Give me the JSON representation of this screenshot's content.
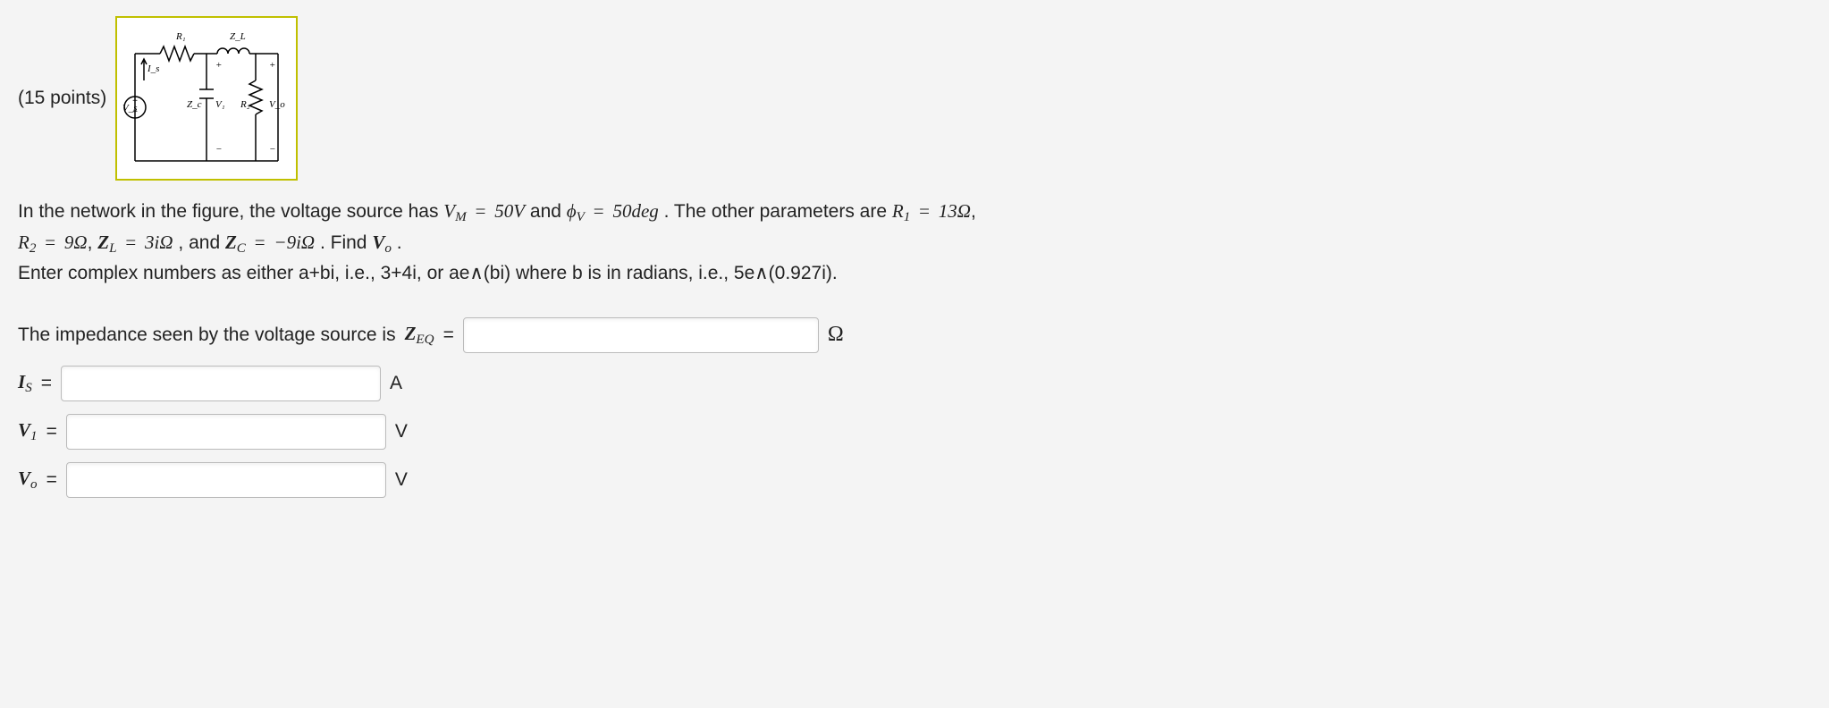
{
  "points_label": "(15 points)",
  "circuit": {
    "labels": {
      "Vs": "V_s",
      "Is": "I_s",
      "R1": "R_1",
      "ZL": "Z_L",
      "Zc": "Z_c",
      "V1": "V_1",
      "R2": "R_2",
      "Vo": "V_o"
    }
  },
  "problem": {
    "lead": "In the network in the figure, the voltage source has ",
    "Vm_lhs": "V_M",
    "Vm_val": "50V",
    "and1": " and ",
    "phi_lhs": "ϕ_V",
    "phi_val": "50deg",
    "other": ". The other parameters are ",
    "R1_lhs": "R_1",
    "R1_val": "13Ω",
    "R2_lhs": "R_2",
    "R2_val": "9Ω",
    "ZL_lhs": "Z_L",
    "ZL_val": "3iΩ",
    "and2": ", and ",
    "ZC_lhs": "Z_C",
    "ZC_val": "−9iΩ",
    "find": ". Find ",
    "Vo_lhs": "V_o",
    "period": ".",
    "hint": "Enter complex numbers as either a+bi, i.e., 3+4i, or ae∧(bi) where b is in radians, i.e., 5e∧(0.927i)."
  },
  "answers": {
    "Zeq_prompt_pre": "The impedance seen by the voltage source is ",
    "Zeq_sym": "Z_EQ",
    "Zeq_unit": "Ω",
    "Is_sym": "I_S",
    "Is_unit": "A",
    "V1_sym": "V_1",
    "V1_unit": "V",
    "Vo_sym": "V_o",
    "Vo_unit": "V",
    "Zeq_value": "",
    "Is_value": "",
    "V1_value": "",
    "Vo_value": ""
  }
}
